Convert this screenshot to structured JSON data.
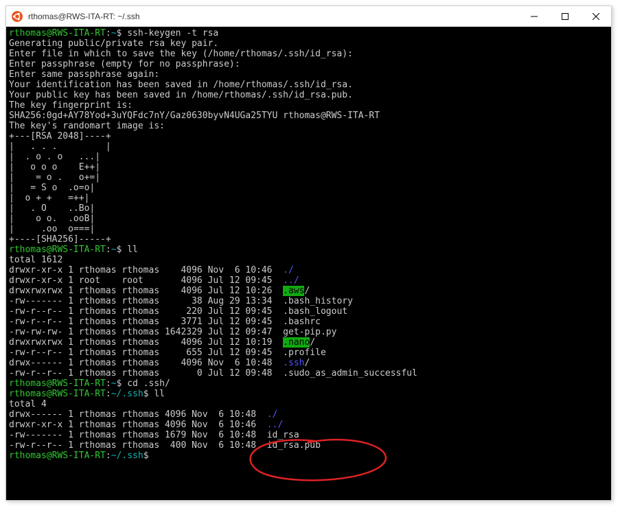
{
  "window": {
    "title": "rthomas@RWS-ITA-RT: ~/.ssh"
  },
  "prompt1": {
    "user_host": "rthomas@RWS-ITA-RT",
    "sep": ":",
    "path": "~",
    "dollar": "$ ",
    "cmd": "ssh-keygen -t rsa"
  },
  "keygen": {
    "l1": "Generating public/private rsa key pair.",
    "l2": "Enter file in which to save the key (/home/rthomas/.ssh/id_rsa):",
    "l3": "Enter passphrase (empty for no passphrase):",
    "l4": "Enter same passphrase again:",
    "l5": "Your identification has been saved in /home/rthomas/.ssh/id_rsa.",
    "l6": "Your public key has been saved in /home/rthomas/.ssh/id_rsa.pub.",
    "l7": "The key fingerprint is:",
    "l8": "SHA256:0gd+AY78Yod+3uYQFdc7nY/Gaz0630byvN4UGa25TYU rthomas@RWS-ITA-RT",
    "l9": "The key's randomart image is:"
  },
  "randomart": [
    "+---[RSA 2048]----+",
    "|   . . .         |",
    "|  . o . o   ...|",
    "|   o o o    E++|",
    "|    = o .   o+=|",
    "|   = S o  .o=o|",
    "|  o + +   =++|",
    "|   . O    ..Bo|",
    "|    o o.  .ooB|",
    "|     .oo  o===|",
    "+----[SHA256]-----+"
  ],
  "prompt2": {
    "user_host": "rthomas@RWS-ITA-RT",
    "sep": ":",
    "path": "~",
    "dollar": "$ ",
    "cmd": "ll"
  },
  "ll1": {
    "header": "total 1612",
    "rows": [
      {
        "perm": "drwxr-xr-x",
        "n": "1",
        "own": "rthomas",
        "grp": "rthomas",
        "size": "   4096",
        "date": "Nov  6 10:46",
        "pad": "  ",
        "name": "./",
        "kind": "dir"
      },
      {
        "perm": "drwxr-xr-x",
        "n": "1",
        "own": "root   ",
        "grp": "root   ",
        "size": "   4096",
        "date": "Jul 12 09:45",
        "pad": "  ",
        "name": "../",
        "kind": "dir"
      },
      {
        "perm": "drwxrwxrwx",
        "n": "1",
        "own": "rthomas",
        "grp": "rthomas",
        "size": "   4096",
        "date": "Jul 12 10:26",
        "pad": "  ",
        "name": ".aws",
        "trail": "/",
        "kind": "hldir"
      },
      {
        "perm": "-rw-------",
        "n": "1",
        "own": "rthomas",
        "grp": "rthomas",
        "size": "     38",
        "date": "Aug 29 13:34",
        "pad": "  ",
        "name": ".bash_history",
        "kind": "file"
      },
      {
        "perm": "-rw-r--r--",
        "n": "1",
        "own": "rthomas",
        "grp": "rthomas",
        "size": "    220",
        "date": "Jul 12 09:45",
        "pad": "  ",
        "name": ".bash_logout",
        "kind": "file"
      },
      {
        "perm": "-rw-r--r--",
        "n": "1",
        "own": "rthomas",
        "grp": "rthomas",
        "size": "   3771",
        "date": "Jul 12 09:45",
        "pad": "  ",
        "name": ".bashrc",
        "kind": "file"
      },
      {
        "perm": "-rw-rw-rw-",
        "n": "1",
        "own": "rthomas",
        "grp": "rthomas",
        "size": "1642329",
        "date": "Jul 12 09:47",
        "pad": "  ",
        "name": "get-pip.py",
        "kind": "file"
      },
      {
        "perm": "drwxrwxrwx",
        "n": "1",
        "own": "rthomas",
        "grp": "rthomas",
        "size": "   4096",
        "date": "Jul 12 10:19",
        "pad": "  ",
        "name": ".nano",
        "trail": "/",
        "kind": "hldir"
      },
      {
        "perm": "-rw-r--r--",
        "n": "1",
        "own": "rthomas",
        "grp": "rthomas",
        "size": "    655",
        "date": "Jul 12 09:45",
        "pad": "  ",
        "name": ".profile",
        "kind": "file"
      },
      {
        "perm": "drwx------",
        "n": "1",
        "own": "rthomas",
        "grp": "rthomas",
        "size": "   4096",
        "date": "Nov  6 10:48",
        "pad": "  ",
        "name": ".ssh",
        "trail": "/",
        "kind": "dir"
      },
      {
        "perm": "-rw-r--r--",
        "n": "1",
        "own": "rthomas",
        "grp": "rthomas",
        "size": "      0",
        "date": "Jul 12 09:48",
        "pad": "  ",
        "name": ".sudo_as_admin_successful",
        "kind": "file"
      }
    ]
  },
  "prompt3": {
    "user_host": "rthomas@RWS-ITA-RT",
    "sep": ":",
    "path": "~",
    "dollar": "$ ",
    "cmd": "cd .ssh/"
  },
  "prompt4": {
    "user_host": "rthomas@RWS-ITA-RT",
    "sep": ":",
    "path": "~/.ssh",
    "dollar": "$ ",
    "cmd": "ll"
  },
  "ll2": {
    "header": "total 4",
    "rows": [
      {
        "perm": "drwx------",
        "n": "1",
        "own": "rthomas",
        "grp": "rthomas",
        "size": "4096",
        "date": "Nov  6 10:48",
        "pad": "  ",
        "name": "./",
        "kind": "dir"
      },
      {
        "perm": "drwxr-xr-x",
        "n": "1",
        "own": "rthomas",
        "grp": "rthomas",
        "size": "4096",
        "date": "Nov  6 10:46",
        "pad": "  ",
        "name": "../",
        "kind": "dir"
      },
      {
        "perm": "-rw-------",
        "n": "1",
        "own": "rthomas",
        "grp": "rthomas",
        "size": "1679",
        "date": "Nov  6 10:48",
        "pad": "  ",
        "name": "id_rsa",
        "kind": "file"
      },
      {
        "perm": "-rw-r--r--",
        "n": "1",
        "own": "rthomas",
        "grp": "rthomas",
        "size": " 400",
        "date": "Nov  6 10:48",
        "pad": "  ",
        "name": "id_rsa.pub",
        "kind": "file"
      }
    ]
  },
  "prompt5": {
    "user_host": "rthomas@RWS-ITA-RT",
    "sep": ":",
    "path": "~/.ssh",
    "dollar": "$ "
  }
}
